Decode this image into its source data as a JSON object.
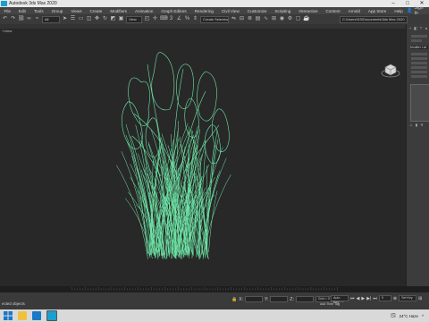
{
  "window": {
    "title": "Autodesk 3ds Max 2020",
    "min": "–",
    "max": "□",
    "close": "✕"
  },
  "menu": {
    "items": [
      "File",
      "Edit",
      "Tools",
      "Group",
      "Views",
      "Create",
      "Modifiers",
      "Animation",
      "Graph Editors",
      "Rendering",
      "Civil View",
      "Customize",
      "Scripting",
      "Interactive",
      "Content",
      "Arnold",
      "App Store",
      "Help"
    ],
    "sign_in": "Sign In"
  },
  "toolbar": {
    "selection_filter": "All",
    "selection_set": "Create Selection Se",
    "path": "C:\\Users\\SS\\Documents\\3ds Max 2020"
  },
  "viewport": {
    "label": "[+] [Perspective] [Standard] [Wireframe]",
    "label_short": "+/view"
  },
  "command_panel": {
    "modifier_list": "Modifier List"
  },
  "timeline": {
    "ticks": [
      "0",
      "10",
      "20",
      "30",
      "40",
      "50",
      "60",
      "70",
      "80",
      "90",
      "100"
    ]
  },
  "status": {
    "left": "None Selected",
    "left_short": "ected objects",
    "x_label": "X:",
    "y_label": "Y:",
    "z_label": "Z:",
    "grid": "Grid = 0'10\"",
    "add_time_tag": "Add Time Tag",
    "auto_key": "Auto Key",
    "set_key": "Set Key",
    "selected": "Selected"
  },
  "taskbar": {
    "weather": "24°C Haze",
    "lang": "ENG",
    "time": "",
    "date": ""
  },
  "colors": {
    "accent": "#1a9fd0",
    "wire": "#6fe8a8"
  }
}
